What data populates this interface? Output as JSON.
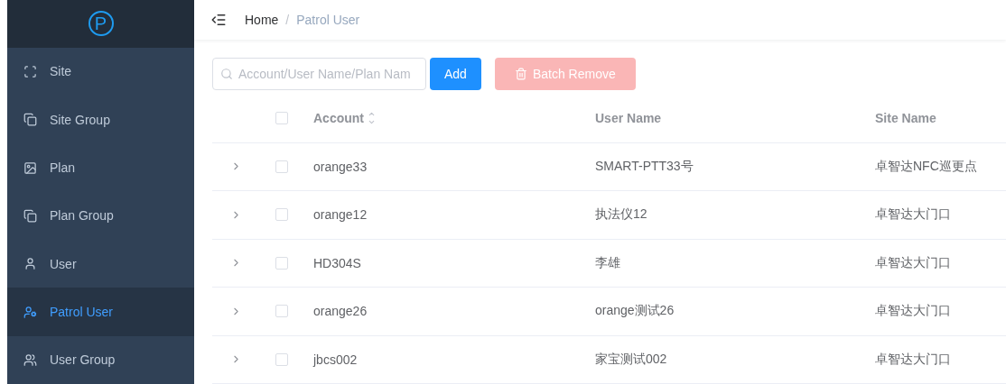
{
  "sidebar": {
    "logo": "P",
    "items": [
      {
        "label": "Site",
        "kind": "site",
        "selected": false
      },
      {
        "label": "Site Group",
        "kind": "group",
        "selected": false
      },
      {
        "label": "Plan",
        "kind": "plan",
        "selected": false
      },
      {
        "label": "Plan Group",
        "kind": "group",
        "selected": false
      },
      {
        "label": "User",
        "kind": "user",
        "selected": false
      },
      {
        "label": "Patrol User",
        "kind": "patrol",
        "selected": true
      },
      {
        "label": "User Group",
        "kind": "users",
        "selected": false
      }
    ]
  },
  "breadcrumb": [
    "Home",
    "Patrol User"
  ],
  "breadcrumb_separator": "/",
  "search": {
    "placeholder": "Account/User Name/Plan Nam"
  },
  "buttons": [
    {
      "label": "Add",
      "kind": "primary",
      "disabled": false
    },
    {
      "label": "Batch Remove",
      "kind": "danger",
      "disabled": true
    }
  ],
  "table": {
    "select_all": {
      "checked": false
    },
    "columns": [
      {
        "label": "Account",
        "sortable": true
      },
      {
        "label": "User Name",
        "sortable": false
      },
      {
        "label": "Site Name",
        "sortable": false
      }
    ],
    "rows": [
      {
        "expanded": false,
        "checked": false,
        "cells": [
          "orange33",
          "SMART-PTT33号",
          "卓智达NFC巡更点"
        ]
      },
      {
        "expanded": false,
        "checked": false,
        "cells": [
          "orange12",
          "执法仪12",
          "卓智达大门口"
        ]
      },
      {
        "expanded": false,
        "checked": false,
        "cells": [
          "HD304S",
          "李雄",
          "卓智达大门口"
        ]
      },
      {
        "expanded": false,
        "checked": false,
        "cells": [
          "orange26",
          "orange测试26",
          "卓智达大门口"
        ]
      },
      {
        "expanded": false,
        "checked": false,
        "cells": [
          "jbcs002",
          "家宝测试002",
          "卓智达大门口"
        ]
      }
    ]
  }
}
